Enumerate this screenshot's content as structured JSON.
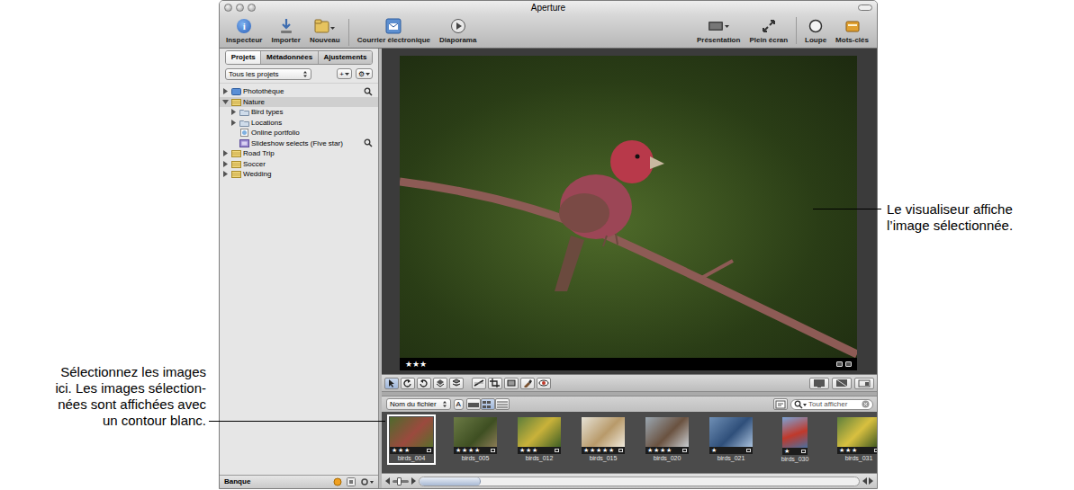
{
  "window": {
    "title": "Aperture"
  },
  "toolbar": {
    "inspector_glyph": "i",
    "left": [
      {
        "label": "Inspecteur"
      },
      {
        "label": "Importer"
      },
      {
        "label": "Nouveau"
      },
      {
        "label": "Courrier électronique"
      },
      {
        "label": "Diaporama"
      }
    ],
    "right": [
      {
        "label": "Présentation"
      },
      {
        "label": "Plein écran"
      },
      {
        "label": "Loupe"
      },
      {
        "label": "Mots-clés"
      }
    ]
  },
  "sidebar": {
    "tabs": [
      {
        "label": "Projets",
        "selected": true
      },
      {
        "label": "Métadonnées",
        "selected": false
      },
      {
        "label": "Ajustements",
        "selected": false
      }
    ],
    "scope_popup": "Tous les projets",
    "add_glyph": "+",
    "action_glyph": "⚙",
    "items": [
      {
        "label": "Photothèque",
        "kind": "library",
        "expanded": false,
        "selected": false,
        "filtered": true,
        "children": []
      },
      {
        "label": "Nature",
        "kind": "project",
        "expanded": true,
        "selected": true,
        "filtered": false,
        "children": [
          {
            "label": "Bird types",
            "kind": "folder",
            "expanded": false,
            "selected": false,
            "filtered": false,
            "children": []
          },
          {
            "label": "Locations",
            "kind": "folder",
            "expanded": false,
            "selected": false,
            "filtered": false,
            "children": []
          },
          {
            "label": "Online portfolio",
            "kind": "web-album",
            "expanded": false,
            "selected": false,
            "filtered": false,
            "children": []
          },
          {
            "label": "Slideshow selects (Five star)",
            "kind": "smart-album",
            "expanded": false,
            "selected": false,
            "filtered": true,
            "children": []
          }
        ]
      },
      {
        "label": "Road Trip",
        "kind": "project",
        "expanded": false,
        "selected": false,
        "filtered": false,
        "children": []
      },
      {
        "label": "Soccer",
        "kind": "project",
        "expanded": false,
        "selected": false,
        "filtered": false,
        "children": []
      },
      {
        "label": "Wedding",
        "kind": "project",
        "expanded": false,
        "selected": false,
        "filtered": false,
        "children": []
      }
    ],
    "footer": "Banque"
  },
  "star_glyph": "★",
  "viewer": {
    "stars": 3
  },
  "browser": {
    "sort_popup": "Nom du fichier",
    "sort_order": "A",
    "views": [
      {
        "selected": false
      },
      {
        "selected": true
      },
      {
        "selected": false
      }
    ],
    "search": {
      "placeholder": "Tout afficher"
    },
    "thumbnails": [
      {
        "label": "birds_004",
        "stars": 3,
        "selected": true,
        "kind": "landscape"
      },
      {
        "label": "birds_005",
        "stars": 4,
        "selected": false,
        "kind": "landscape"
      },
      {
        "label": "birds_012",
        "stars": 3,
        "selected": false,
        "kind": "landscape"
      },
      {
        "label": "birds_015",
        "stars": 5,
        "selected": false,
        "kind": "landscape"
      },
      {
        "label": "birds_020",
        "stars": 4,
        "selected": false,
        "kind": "landscape"
      },
      {
        "label": "birds_021",
        "stars": 1,
        "selected": false,
        "kind": "landscape"
      },
      {
        "label": "birds_030",
        "stars": 1,
        "selected": false,
        "kind": "portrait"
      },
      {
        "label": "birds_031",
        "stars": 3,
        "selected": false,
        "kind": "landscape"
      }
    ],
    "size_slider": {
      "level": 0.4
    },
    "scrollbar": {
      "level": 0.14
    }
  },
  "callouts": {
    "viewer": [
      "Le visualiseur affiche",
      "l’image sélectionnée."
    ],
    "browser": [
      "Sélectionnez les images",
      "ici. Les images sélection-",
      "nées sont affichées avec",
      "un contour blanc."
    ]
  }
}
